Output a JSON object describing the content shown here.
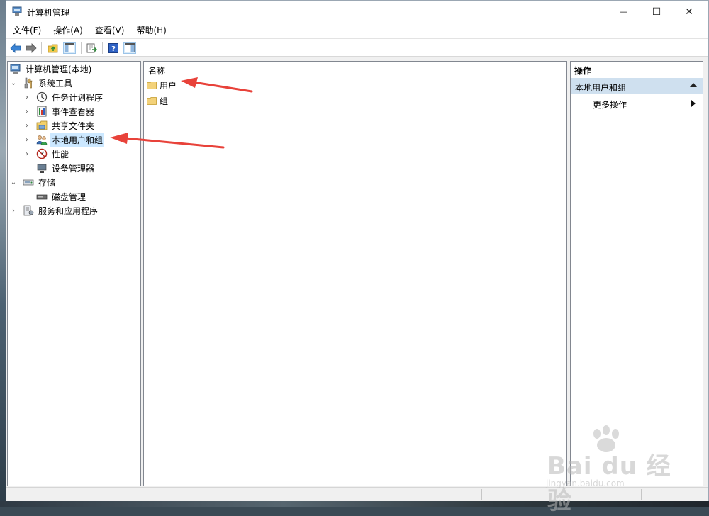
{
  "window": {
    "title": "计算机管理",
    "controls": {
      "minimize": "—",
      "maximize": "☐",
      "close": "✕"
    }
  },
  "menu": [
    "文件(F)",
    "操作(A)",
    "查看(V)",
    "帮助(H)"
  ],
  "toolbar": [
    "back-icon",
    "forward-icon",
    "up-folder-icon",
    "show-tree-icon",
    "export-icon",
    "help-icon",
    "properties-icon"
  ],
  "tree": {
    "root": "计算机管理(本地)",
    "items": [
      {
        "label": "系统工具",
        "icon": "tools-icon"
      },
      {
        "label": "任务计划程序",
        "icon": "clock-icon"
      },
      {
        "label": "事件查看器",
        "icon": "event-viewer-icon"
      },
      {
        "label": "共享文件夹",
        "icon": "shared-folder-icon"
      },
      {
        "label": "本地用户和组",
        "icon": "users-icon"
      },
      {
        "label": "性能",
        "icon": "performance-icon"
      },
      {
        "label": "设备管理器",
        "icon": "device-manager-icon"
      },
      {
        "label": "存储",
        "icon": "storage-icon"
      },
      {
        "label": "磁盘管理",
        "icon": "disk-icon"
      },
      {
        "label": "服务和应用程序",
        "icon": "services-icon"
      }
    ]
  },
  "list": {
    "column": "名称",
    "items": [
      "用户",
      "组"
    ]
  },
  "actions": {
    "title": "操作",
    "section": "本地用户和组",
    "more": "更多操作"
  },
  "watermark": {
    "brand": "Bai du 经验",
    "url": "jingyan.baidu.com"
  },
  "colors": {
    "selection": "#cce8ff",
    "section_bg": "#cfe0ef",
    "annotation_arrow": "#e8423a"
  }
}
